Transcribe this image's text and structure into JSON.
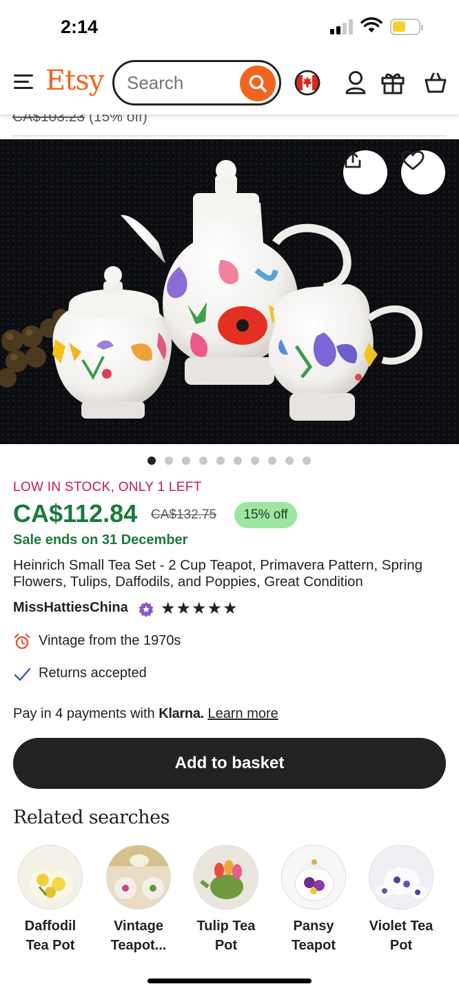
{
  "status_bar": {
    "time": "2:14"
  },
  "header": {
    "logo": "Etsy",
    "search_placeholder": "Search",
    "brand_color": "#f1641e",
    "icons": [
      "menu-icon",
      "search-icon",
      "canada-flag-icon",
      "account-icon",
      "gift-icon",
      "basket-icon"
    ]
  },
  "peek": {
    "previous_price_text": "CA$103.23",
    "previous_off_text": "(15% off)"
  },
  "image": {
    "image_count": 10,
    "active_index": 0
  },
  "product": {
    "stock_alert": "LOW IN STOCK, ONLY 1 LEFT",
    "price": "CA$112.84",
    "original_price": "CA$132.75",
    "discount": "15% off",
    "sale_ends": "Sale ends on 31 December",
    "title": "Heinrich Small Tea Set - 2 Cup Teapot, Primavera Pattern, Spring Flowers, Tulips, Daffodils, and Poppies, Great Condition",
    "shop_name": "MissHattiesChina",
    "rating_stars": "★★★★★",
    "rating_value": 5,
    "features": {
      "vintage": "Vintage from the 1970s",
      "returns": "Returns accepted"
    },
    "payment": {
      "prefix": "Pay in 4 payments with",
      "provider": "Klarna.",
      "link": "Learn more"
    },
    "add_to_basket": "Add to basket"
  },
  "related": {
    "heading": "Related searches",
    "items": [
      {
        "label": "Daffodil Tea Pot"
      },
      {
        "label": "Vintage Teapot..."
      },
      {
        "label": "Tulip Tea Pot"
      },
      {
        "label": "Pansy Teapot"
      },
      {
        "label": "Violet Tea Pot"
      }
    ]
  },
  "colors": {
    "price_green": "#1b7a3a",
    "alert_red": "#c2185b",
    "badge_green": "#9ee6a0",
    "button_dark": "#222222"
  }
}
